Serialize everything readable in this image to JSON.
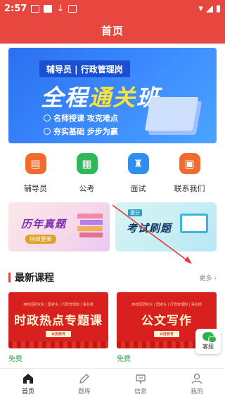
{
  "statusbar": {
    "time": "2:57"
  },
  "appbar": {
    "title": "首页"
  },
  "banner": {
    "tag": "辅导员 | 行政管理岗",
    "title_pre": "全程",
    "title_hl": "通关",
    "title_post": "班",
    "bullets": [
      "名师授课 攻克难点",
      "夯实基础 步步为赢"
    ]
  },
  "quicknav": [
    {
      "label": "辅导员",
      "color": "#f26a2e",
      "icon": "book-icon"
    },
    {
      "label": "公考",
      "color": "#2fb85a",
      "icon": "document-icon"
    },
    {
      "label": "面试",
      "color": "#2f8ff0",
      "icon": "podium-icon"
    },
    {
      "label": "联系我们",
      "color": "#f26a2e",
      "icon": "contact-icon"
    }
  ],
  "cards": [
    {
      "title": "历年真题",
      "sub": "持续更新"
    },
    {
      "title": "考试刷题",
      "badge": "提分"
    }
  ],
  "section": {
    "title": "最新课程",
    "more": "更多 ›"
  },
  "courses": [
    {
      "top": "西校园研究生 | 国考生 | 行政管理岗 | 事业岗",
      "title": "时政热点专题课",
      "pill": "百度教育",
      "price": "免费"
    },
    {
      "top": "西校园研究生 | 国考生 | 行政管理岗 | 事业岗",
      "title": "公文写作",
      "pill": "百度教育",
      "price": "免费"
    }
  ],
  "customer_service": {
    "label": "客服"
  },
  "tabs": [
    {
      "label": "首页",
      "icon": "home-icon",
      "active": true
    },
    {
      "label": "题库",
      "icon": "pencil-icon",
      "active": false
    },
    {
      "label": "信息",
      "icon": "message-icon",
      "active": false
    },
    {
      "label": "我的",
      "icon": "user-icon",
      "active": false
    }
  ]
}
